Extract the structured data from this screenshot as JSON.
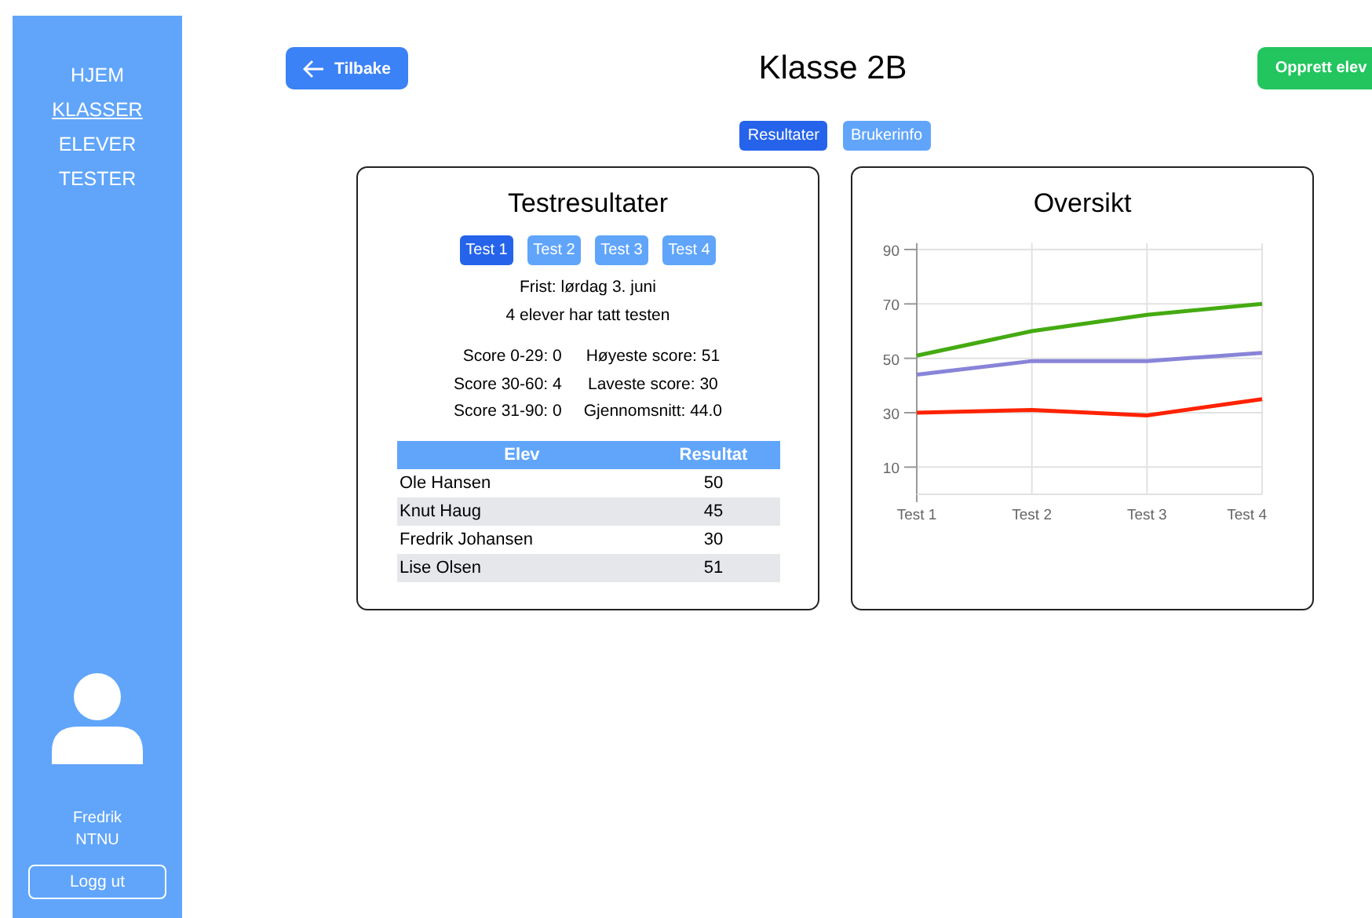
{
  "sidebar": {
    "items": [
      {
        "label": "HJEM",
        "selected": false
      },
      {
        "label": "KLASSER",
        "selected": true
      },
      {
        "label": "ELEVER",
        "selected": false
      },
      {
        "label": "TESTER",
        "selected": false
      }
    ],
    "user": {
      "name": "Fredrik",
      "org": "NTNU"
    },
    "logout": "Logg ut"
  },
  "header": {
    "back": "Tilbake",
    "title": "Klasse 2B",
    "create": "Opprett elev"
  },
  "tabs": [
    {
      "label": "Resultater",
      "selected": true
    },
    {
      "label": "Brukerinfo",
      "selected": false
    }
  ],
  "results": {
    "title": "Testresultater",
    "tests": [
      {
        "label": "Test 1",
        "selected": true
      },
      {
        "label": "Test 2",
        "selected": false
      },
      {
        "label": "Test 3",
        "selected": false
      },
      {
        "label": "Test 4",
        "selected": false
      }
    ],
    "info": [
      "Frist: lørdag 3. juni",
      "4 elever har tatt testen"
    ],
    "stats_left": [
      "Score 0-29: 0",
      "Score 30-60: 4",
      "Score 31-90: 0"
    ],
    "stats_right": [
      "Høyeste score: 51",
      "Laveste score: 30",
      "Gjennomsnitt: 44.0"
    ],
    "table": {
      "columns": [
        "Elev",
        "Resultat"
      ],
      "rows": [
        [
          "Ole Hansen",
          "50"
        ],
        [
          "Knut Haug",
          "45"
        ],
        [
          "Fredrik Johansen",
          "30"
        ],
        [
          "Lise Olsen",
          "51"
        ]
      ]
    }
  },
  "overview": {
    "title": "Oversikt",
    "chart_data": {
      "type": "line",
      "grid": true,
      "categories": [
        "Test 1",
        "Test 2",
        "Test 3",
        "Test 4"
      ],
      "ylim": [
        0,
        90
      ],
      "yticks": [
        10,
        30,
        50,
        70,
        90
      ],
      "series": [
        {
          "color": "#44aa11",
          "values": [
            51,
            60,
            66,
            70
          ]
        },
        {
          "color": "#8884d8",
          "values": [
            44,
            49,
            49,
            52
          ]
        },
        {
          "color": "#ff2200",
          "values": [
            30,
            31,
            29,
            35
          ]
        }
      ]
    }
  }
}
